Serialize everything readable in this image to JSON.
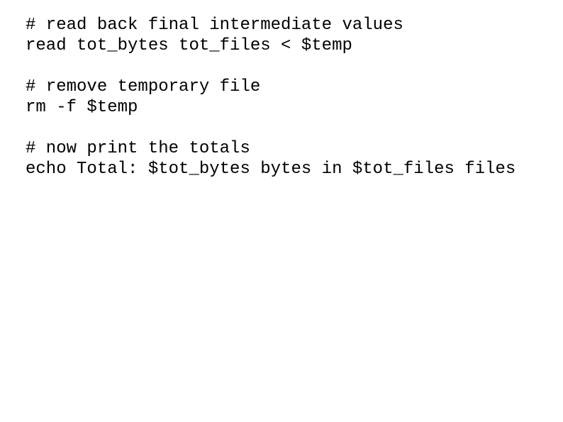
{
  "slide": {
    "background_color": "#ffffff",
    "text_color": "#000000",
    "code_lines": [
      {
        "text": "# read back final intermediate values",
        "kind": "comment"
      },
      {
        "text": "read tot_bytes tot_files < $temp",
        "kind": "command"
      },
      {
        "text": "",
        "kind": "blank"
      },
      {
        "text": "# remove temporary file",
        "kind": "comment"
      },
      {
        "text": "rm -f $temp",
        "kind": "command"
      },
      {
        "text": "",
        "kind": "blank"
      },
      {
        "text": "# now print the totals",
        "kind": "comment"
      },
      {
        "text": "echo Total: $tot_bytes bytes in $tot_files files",
        "kind": "command"
      }
    ]
  }
}
